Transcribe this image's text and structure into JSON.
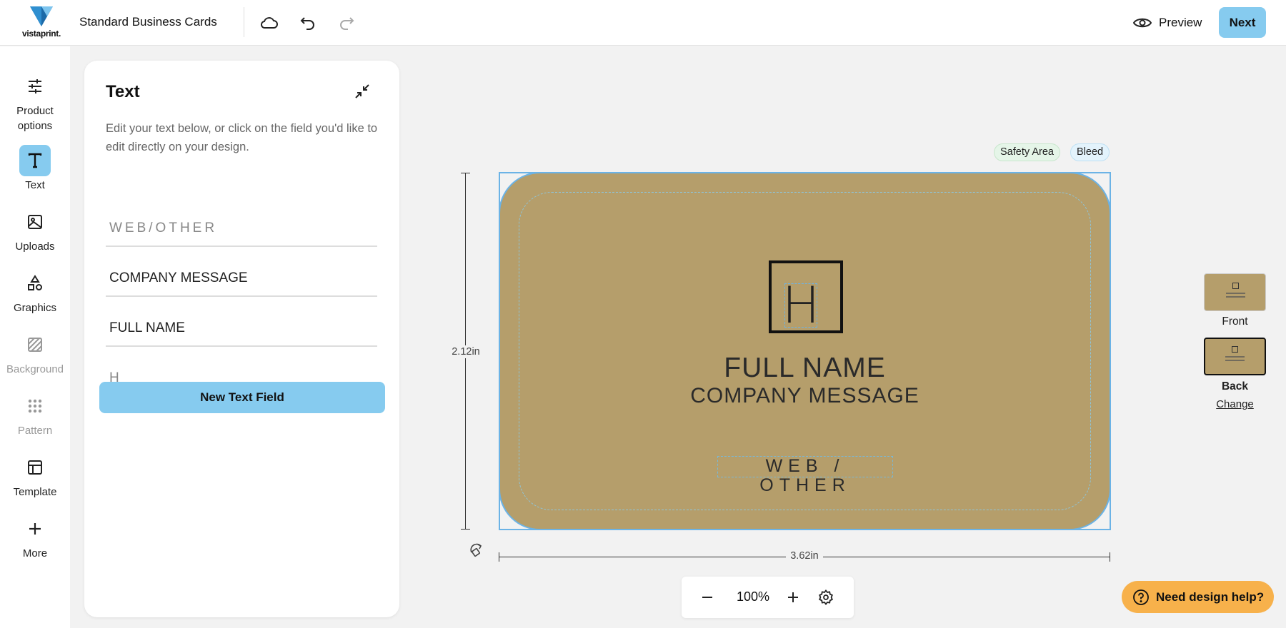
{
  "app": {
    "logo_text": "vistaprint.",
    "document_title": "Standard Business Cards"
  },
  "toolbar": {
    "preview_label": "Preview",
    "next_label": "Next",
    "icons": [
      "cloud-save-icon",
      "undo-icon",
      "redo-icon"
    ]
  },
  "rail": {
    "items": [
      {
        "label_line1": "Product",
        "label_line2": "options",
        "icon": "sliders-icon"
      },
      {
        "label": "Text",
        "icon": "text-icon",
        "active": true
      },
      {
        "label": "Uploads",
        "icon": "image-icon"
      },
      {
        "label": "Graphics",
        "icon": "shapes-icon"
      },
      {
        "label": "Background",
        "icon": "background-icon",
        "disabled": true
      },
      {
        "label": "Pattern",
        "icon": "pattern-icon",
        "disabled": true
      },
      {
        "label": "Template",
        "icon": "template-icon"
      },
      {
        "label": "More",
        "icon": "plus-icon"
      }
    ]
  },
  "panel": {
    "title": "Text",
    "description": "Edit your text below, or click on the field you'd like to edit directly on your design.",
    "fields": [
      "WEB/OTHER",
      "COMPANY MESSAGE",
      "FULL NAME",
      "H"
    ],
    "new_field_label": "New Text Field"
  },
  "canvas": {
    "badges": {
      "safety": "Safety Area",
      "bleed": "Bleed"
    },
    "height_label": "2.12in",
    "width_label": "3.62in",
    "card": {
      "logo_letter": "H",
      "full_name": "FULL NAME",
      "company_message": "COMPANY MESSAGE",
      "web_other": "WEB / OTHER",
      "background_color": "#b59e6b"
    }
  },
  "sides": {
    "front_label": "Front",
    "back_label": "Back",
    "change_label": "Change"
  },
  "zoom": {
    "value": "100%"
  },
  "help": {
    "label": "Need design help?"
  },
  "colors": {
    "accent": "#86cbef",
    "help": "#f7b14b",
    "selection": "#6bb3e6"
  }
}
